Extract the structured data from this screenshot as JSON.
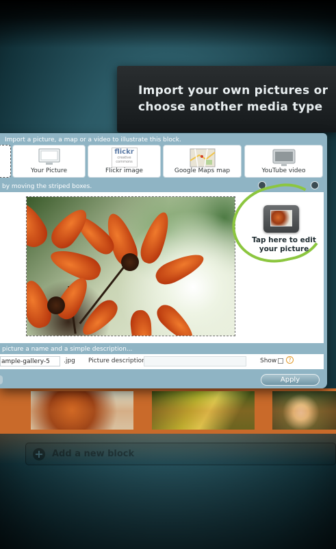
{
  "tooltip": {
    "line1": "Import your own pictures or",
    "line2": "choose another media type"
  },
  "dialog": {
    "header": "Import a picture, a map or a video to illustrate this block.",
    "media_types": [
      {
        "label": "Your Picture",
        "icon": "monitor-icon"
      },
      {
        "label": "Flickr image",
        "icon": "flickr-logo-icon",
        "logo_text": "flickr",
        "logo_sub": "creative commons"
      },
      {
        "label": "Google Maps map",
        "icon": "map-icon"
      },
      {
        "label": "YouTube video",
        "icon": "video-icon"
      }
    ],
    "stripe_hint": "by moving the striped boxes.",
    "edit_hint": {
      "line1": "Tap here to edit",
      "line2": "your picture"
    },
    "description_hint": "picture a name and a simple description...",
    "name_value": "ample-gallery-5",
    "extension": ".jpg",
    "description_label": "Picture description",
    "description_value": "",
    "show_label": "Show",
    "help_symbol": "?",
    "apply_label": "Apply"
  },
  "background": {
    "add_block_label": "Add a new block",
    "add_block_symbol": "+"
  },
  "colors": {
    "accent_green": "#8cc63f",
    "dialog_blue": "#8fb4c4",
    "gallery_orange": "#c96a2a"
  }
}
